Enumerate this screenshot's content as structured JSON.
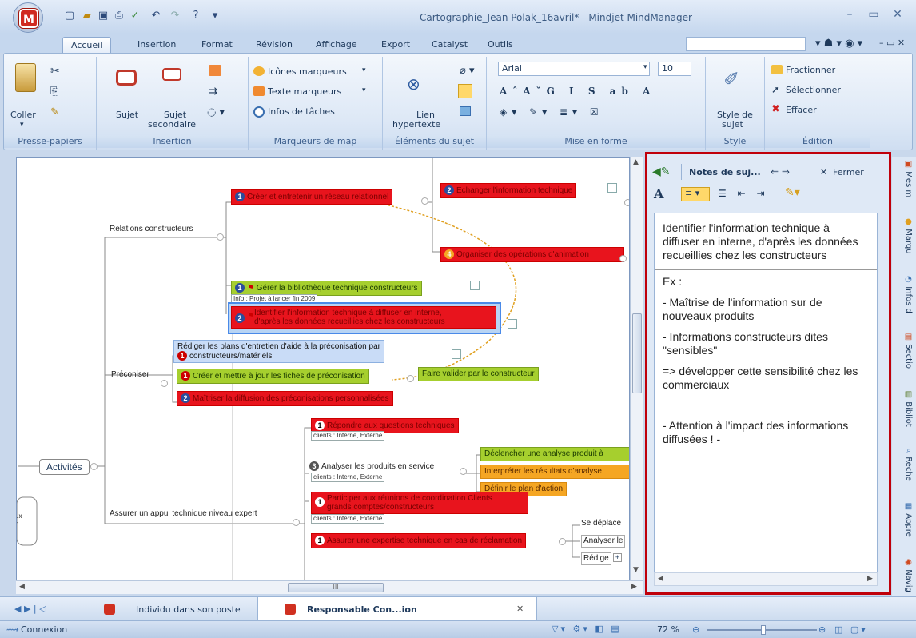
{
  "window": {
    "title": "Cartographie_Jean Polak_16avril* - Mindjet MindManager",
    "app_logo": "M"
  },
  "ribbon_tabs": [
    "Accueil",
    "Insertion",
    "Format",
    "Révision",
    "Affichage",
    "Export",
    "Catalyst",
    "Outils"
  ],
  "ribbon": {
    "presse_papiers": {
      "label": "Presse-papiers",
      "coller": "Coller"
    },
    "insertion": {
      "label": "Insertion",
      "sujet": "Sujet",
      "sujet_secondaire_1": "Sujet",
      "sujet_secondaire_2": "secondaire"
    },
    "marqueurs": {
      "label": "Marqueurs de map",
      "icones": "Icônes marqueurs",
      "texte": "Texte marqueurs",
      "infos": "Infos de tâches"
    },
    "elements": {
      "label": "Éléments du sujet",
      "lien_1": "Lien",
      "lien_2": "hypertexte"
    },
    "mise_en_forme": {
      "label": "Mise en forme",
      "font": "Arial",
      "size": "10"
    },
    "style": {
      "label": "Style",
      "style_1": "Style de",
      "style_2": "sujet"
    },
    "edition": {
      "label": "Édition",
      "fractionner": "Fractionner",
      "selectionner": "Sélectionner",
      "effacer": "Effacer"
    }
  },
  "map": {
    "central": "Activités",
    "relations": "Relations constructeurs",
    "preconiser": "Préconiser",
    "assurer": "Assurer un appui technique niveau expert",
    "t_creer_reseau": "Créer et entretenir un réseau relationnel",
    "t_echanger": "Echanger l'information technique",
    "t_organiser": "Organiser des opérations d'animation",
    "t_gerer": "Gérer la bibliothèque technique constructeurs",
    "t_gerer_info": "Info : Projet à lancer fin 2009",
    "t_identifier_1": "Identifier l'information technique à diffuser en interne,",
    "t_identifier_2": "d'après les données recueillies chez les constructeurs",
    "t_rediger_1": "Rédiger les plans d'entretien d'aide à la préconisation par",
    "t_rediger_2": "constructeurs/matériels",
    "t_creer_fiches": "Créer et mettre à jour les fiches de préconisation",
    "t_faire_valider": "Faire valider par le constructeur",
    "t_maitriser": "Maîtriser la diffusion des préconisations personnalisées",
    "t_repondre": "Répondre aux questions techniques",
    "t_repondre_info": "clients : Interne, Externe",
    "t_analyser": "Analyser les produits en service",
    "t_analyser_info": "clients : Interne, Externe",
    "t_declencher": "Déclencher une analyse produit à",
    "t_interpreter": "Interpréter les résultats d'analyse",
    "t_definir": "Définir le plan d'action",
    "t_participer_1": "Participer aux réunions de coordination Clients",
    "t_participer_2": "grands comptes/constructeurs",
    "t_participer_info": "clients : Interne, Externe",
    "t_assurer_expertise": "Assurer une expertise technique en cas de réclamation",
    "t_se_deplacer": "Se déplace",
    "t_analyser_l": "Analyser le",
    "t_redige": "Rédige",
    "left_fragment_1": "ux",
    "left_fragment_2": "n"
  },
  "notes": {
    "title": "Notes de suj...",
    "close": "Fermer",
    "p1": "Identifier l'information technique à diffuser en interne, d'après les données recueillies chez les constructeurs",
    "p2": "Ex :",
    "p3": "- Maîtrise de l'information sur de nouveaux produits",
    "p4": "- Informations constructeurs dites \"sensibles\"",
    "p5": "=> développer cette sensibilité chez les commerciaux",
    "p6": "- Attention à l'impact des informations diffusées ! -"
  },
  "side_tabs": [
    "Mes m",
    "Marqu",
    "Infos d",
    "Sectio",
    "Bibliot",
    "Reche",
    "Appre",
    "Navig"
  ],
  "doc_tabs": [
    "Individu dans son poste",
    "Responsable Con...ion"
  ],
  "status": {
    "connexion": "Connexion",
    "zoom": "72 %"
  },
  "scroll": {
    "h_grip": "III"
  }
}
